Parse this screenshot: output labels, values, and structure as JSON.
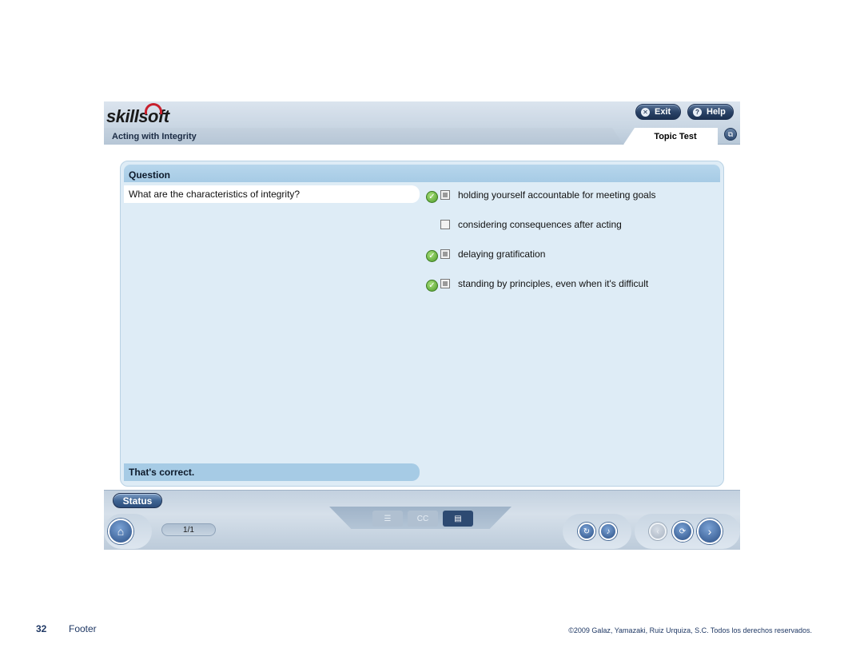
{
  "header": {
    "logo": "skillsoft",
    "course_title": "Acting with Integrity",
    "exit_label": "Exit",
    "help_label": "Help",
    "active_tab": "Topic Test"
  },
  "question": {
    "heading": "Question",
    "text": "What are the characteristics of integrity?",
    "answers": [
      {
        "label": "holding yourself accountable for meeting goals",
        "correct": true,
        "selected": true
      },
      {
        "label": "considering consequences after acting",
        "correct": false,
        "selected": false
      },
      {
        "label": "delaying gratification",
        "correct": true,
        "selected": true
      },
      {
        "label": "standing by principles, even when it's difficult",
        "correct": true,
        "selected": true
      }
    ],
    "feedback": "That's correct."
  },
  "bottom_bar": {
    "status_label": "Status",
    "page_indicator": "1/1"
  },
  "footer": {
    "page_number": "32",
    "label": "Footer",
    "copyright": "©2009 Galaz, Yamazaki, Ruiz Urquiza, S.C. Todos los derechos reservados."
  },
  "icons": {
    "exit": "close-icon",
    "help": "question-icon",
    "home": "home-icon",
    "correct": "checkmark-icon"
  }
}
